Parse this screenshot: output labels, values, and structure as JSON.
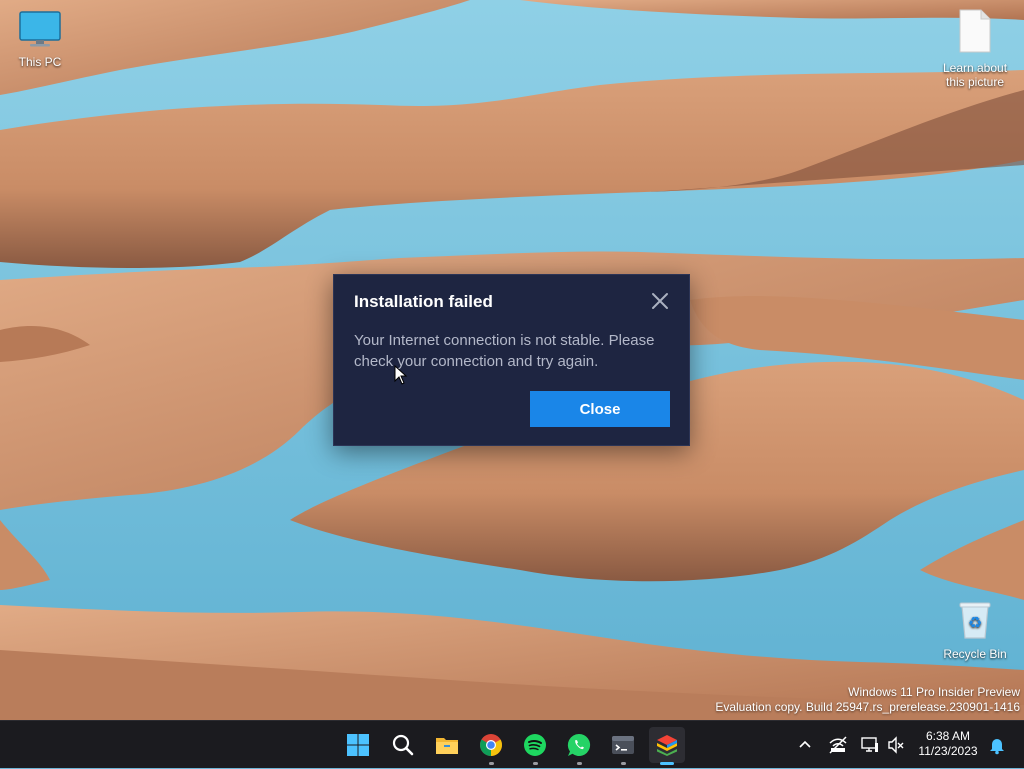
{
  "desktop": {
    "icons": [
      {
        "label": "This PC",
        "icon": "monitor-icon"
      },
      {
        "label": "Learn about this picture",
        "icon": "document-icon"
      },
      {
        "label": "Recycle Bin",
        "icon": "recycle-bin-icon"
      }
    ],
    "watermark": {
      "line1": "Windows 11 Pro Insider Preview",
      "line2": "Evaluation copy. Build 25947.rs_prerelease.230901-1416"
    }
  },
  "dialog": {
    "title": "Installation failed",
    "message": "Your Internet connection is not stable. Please check your connection and try again.",
    "close_button": "Close",
    "accent_color": "#1a86e8",
    "background_color": "#1e2541"
  },
  "taskbar": {
    "apps": [
      {
        "name": "Start",
        "icon": "windows-start-icon"
      },
      {
        "name": "Search",
        "icon": "search-icon"
      },
      {
        "name": "File Explorer",
        "icon": "folder-icon"
      },
      {
        "name": "Google Chrome",
        "icon": "chrome-icon"
      },
      {
        "name": "Spotify",
        "icon": "spotify-icon"
      },
      {
        "name": "WhatsApp",
        "icon": "whatsapp-icon"
      },
      {
        "name": "Terminal",
        "icon": "terminal-icon"
      },
      {
        "name": "BlueStacks",
        "icon": "bluestacks-icon"
      }
    ],
    "tray": {
      "icons": [
        "chevron-up-icon",
        "network-off-icon",
        "display-icon",
        "volume-muted-icon",
        "notification-bell-icon"
      ],
      "time": "6:38 AM",
      "date": "11/23/2023"
    }
  }
}
